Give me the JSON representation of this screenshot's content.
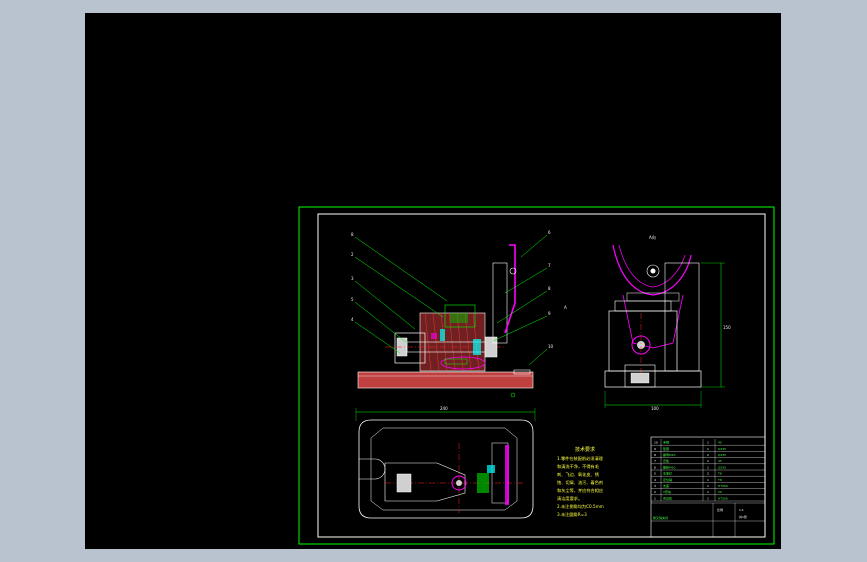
{
  "viewer": {
    "background_color": "#b9c3cf",
    "canvas_color": "#000000"
  },
  "drawing": {
    "frame_color": "#00ff00",
    "accent_magenta": "#ff00ff",
    "accent_cyan": "#00ffff",
    "accent_red": "#ff2020",
    "view_label_side": "A向",
    "leaders_left": [
      "8",
      "2",
      "3",
      "5",
      "4"
    ],
    "leaders_right": [
      "6",
      "7",
      "8",
      "9",
      "10"
    ],
    "dim_top_width": "240",
    "dim_side_height": "150",
    "dim_side_width": "100",
    "section_label": "A",
    "tech_notes": {
      "title": "技术要求",
      "lines": [
        "1.零件在装配前必须清理",
        "和清洗干净，不得有毛",
        "刺、飞边、氧化皮、锈",
        "蚀、切屑、油污、着色剂",
        "和灰尘等，并应符合相应",
        "清洁度要求。",
        "2.未注倒角均为C0.5mm",
        "3.未注圆角R=3"
      ]
    },
    "title_block": {
      "part_rows": [
        {
          "no": "10",
          "name": "手柄",
          "qty": "1",
          "material": "45"
        },
        {
          "no": "9",
          "name": "垫圈",
          "qty": "1",
          "material": "Q235"
        },
        {
          "no": "8",
          "name": "螺母M10",
          "qty": "2",
          "material": "Q235"
        },
        {
          "no": "7",
          "name": "压板",
          "qty": "1",
          "material": "45"
        },
        {
          "no": "6",
          "name": "螺栓M10",
          "qty": "1",
          "material": "Q235"
        },
        {
          "no": "5",
          "name": "支承钉",
          "qty": "2",
          "material": "T8"
        },
        {
          "no": "4",
          "name": "定位销",
          "qty": "1",
          "material": "T8"
        },
        {
          "no": "3",
          "name": "支座",
          "qty": "1",
          "material": "HT200"
        },
        {
          "no": "2",
          "name": "V形块",
          "qty": "1",
          "material": "20"
        },
        {
          "no": "1",
          "name": "夹具体",
          "qty": "1",
          "material": "HT200"
        }
      ],
      "drawing_name": "拨叉铣夹具",
      "scale_label": "比例",
      "scale_value": "1:1",
      "sheet_label": "共1张"
    }
  }
}
